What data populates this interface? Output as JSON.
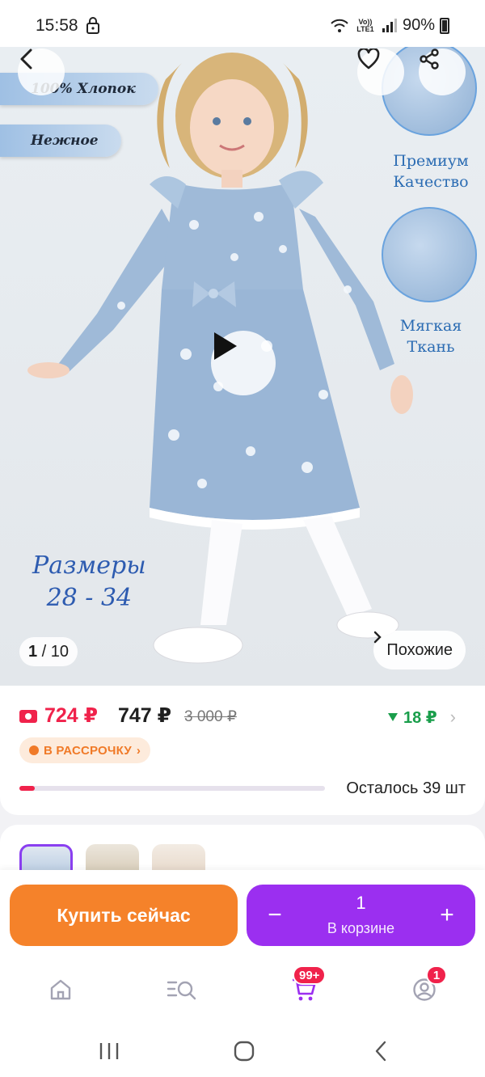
{
  "status_bar": {
    "time": "15:58",
    "network": "Vo)) LTE1",
    "battery": "90%"
  },
  "gallery": {
    "tags": [
      "100% Хлопок",
      "Нежное"
    ],
    "promo_premium": [
      "Премиум",
      "Качество"
    ],
    "promo_soft": [
      "Мягкая",
      "Ткань"
    ],
    "sizes_title": "Размеры",
    "sizes_range": "28 - 34",
    "counter_current": "1",
    "counter_total": "/ 10",
    "similar_label": "Похожие"
  },
  "price": {
    "sale_price": "724 ₽",
    "price": "747 ₽",
    "old_price": "3 000 ₽",
    "cashback": "18 ₽",
    "installment_label": "В РАССРОЧКУ",
    "stock_label": "Осталось 39 шт",
    "stock_level": 0.05
  },
  "actions": {
    "buy_now": "Купить сейчас",
    "quantity": "1",
    "in_cart": "В корзине",
    "minus": "−",
    "plus": "+"
  },
  "bottom_nav": {
    "items": [
      "home-icon",
      "catalog-search-icon",
      "cart-icon",
      "profile-icon"
    ],
    "cart_badge": "99+",
    "profile_badge": "1"
  },
  "colors": {
    "sale": "#f0224b",
    "buy_button": "#f5822a",
    "cart_button": "#9b2ff0",
    "cashback": "#1a9e4b"
  }
}
